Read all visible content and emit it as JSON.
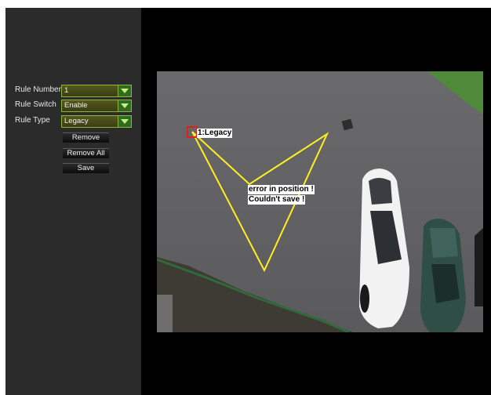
{
  "sidebar": {
    "rule_number": {
      "label": "Rule Number",
      "value": "1"
    },
    "rule_switch": {
      "label": "Rule Switch",
      "value": "Enable"
    },
    "rule_type": {
      "label": "Rule Type",
      "value": "Legacy"
    },
    "buttons": {
      "remove": "Remove",
      "remove_all": "Remove All",
      "save": "Save"
    }
  },
  "video": {
    "rule_tag": "1:Legacy",
    "error_line1": "error in position !",
    "error_line2": "Couldn't save !"
  },
  "colors": {
    "select_border": "#8fb43a",
    "rule_line": "#ffee22",
    "marker": "#e02020"
  }
}
